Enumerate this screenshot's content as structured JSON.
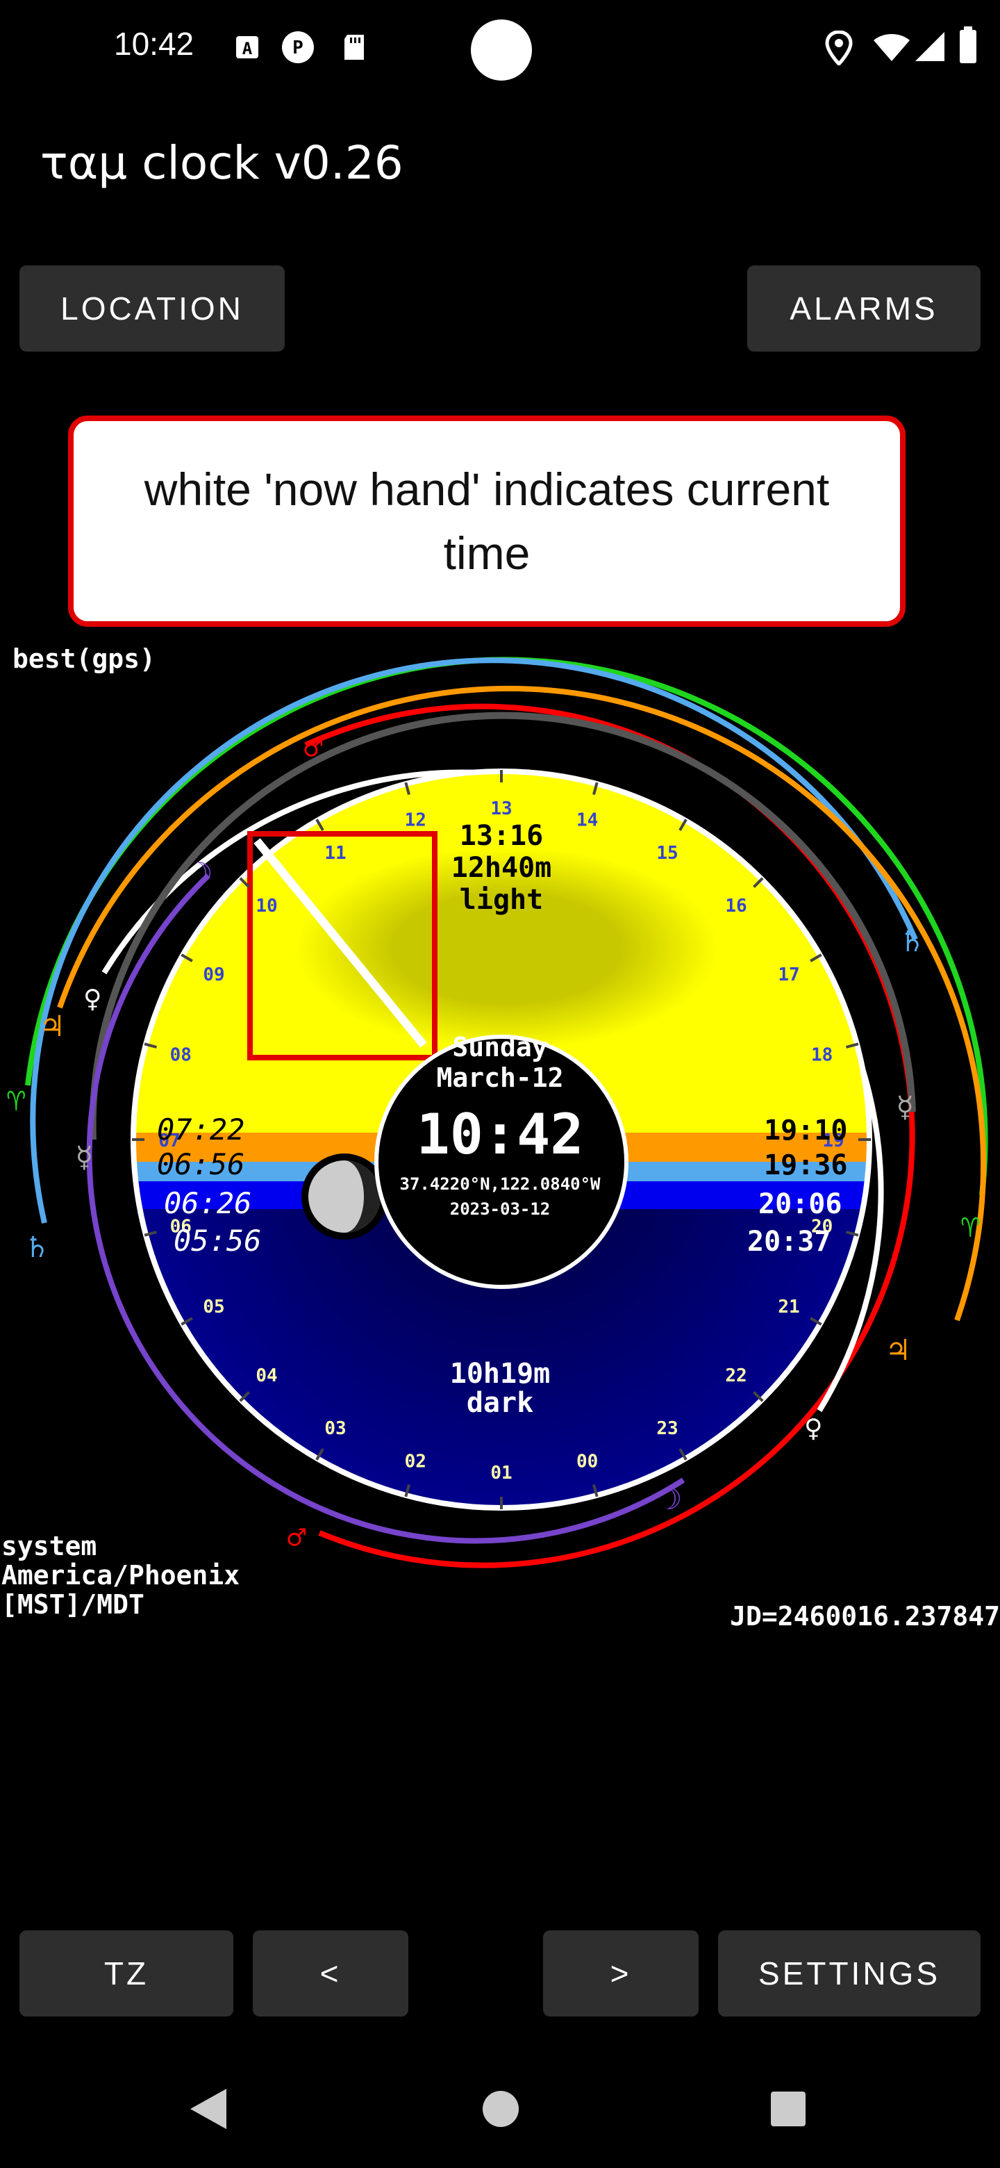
{
  "status_bar": {
    "time": "10:42",
    "left_icons": [
      "a-notification-icon",
      "p-notification-icon",
      "sd-card-icon"
    ],
    "right_icons": [
      "location-icon",
      "wifi-icon",
      "signal-icon",
      "battery-icon"
    ]
  },
  "app": {
    "title": "ταμ clock v0.26"
  },
  "top_buttons": {
    "location": "LOCATION",
    "alarms": "ALARMS"
  },
  "tooltip": {
    "text": "white 'now hand' indicates current time"
  },
  "location_mode": "best(gps)",
  "clock": {
    "day_name": "Sunday",
    "date_label": "March-12",
    "time": "10:42",
    "coordinates": "37.4220°N,122.0840°W",
    "date": "2023-03-12",
    "noon_time": "13:16",
    "light_duration": "12h40m",
    "light_label": "light",
    "dark_duration": "10h19m",
    "dark_label": "dark",
    "morning_times": [
      "07:22",
      "06:56",
      "06:26",
      "05:56"
    ],
    "evening_times": [
      "19:10",
      "19:36",
      "20:06",
      "20:37"
    ],
    "hour_labels": [
      "00",
      "01",
      "02",
      "03",
      "04",
      "05",
      "06",
      "07",
      "08",
      "09",
      "10",
      "11",
      "12",
      "13",
      "14",
      "15",
      "16",
      "17",
      "18",
      "19",
      "20",
      "21",
      "22",
      "23"
    ],
    "colors": {
      "day": "#ffff00",
      "civil": "#ff9900",
      "nautical": "#55aaee",
      "astronomical": "#0000ee",
      "night": "#000080",
      "now_hand": "#ffffff"
    },
    "planet_symbols": {
      "moon": "☽",
      "mercury": "☿",
      "venus": "♀",
      "mars": "♂",
      "jupiter": "♃",
      "saturn": "♄",
      "aries": "♈"
    }
  },
  "timezone": {
    "source": "system",
    "name": "America/Phoenix",
    "abbr": "[MST]/MDT"
  },
  "julian_date": "JD=2460016.237847",
  "bottom_buttons": {
    "tz": "TZ",
    "prev": "<",
    "next": ">",
    "settings": "SETTINGS"
  },
  "nav_bar": [
    "back-icon",
    "home-icon",
    "recents-icon"
  ]
}
